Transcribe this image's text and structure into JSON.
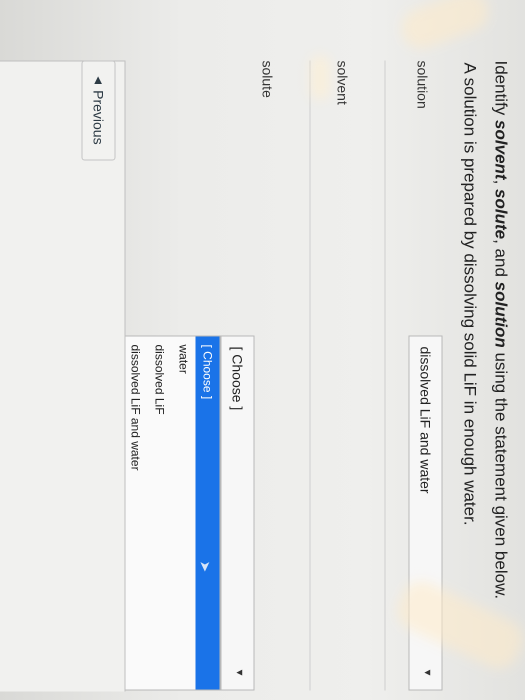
{
  "question": {
    "prompt_start": "Identify ",
    "term1": "solvent",
    "sep1": ", ",
    "term2": "solute",
    "sep2": ", and ",
    "term3": "solution",
    "prompt_end": " using the statement given below.",
    "statement": "A solution is prepared by dissolving solid LiF in enough water."
  },
  "rows": [
    {
      "label": "solution",
      "selected": "dissolved LiF and water"
    },
    {
      "label": "solvent",
      "selected": "[ Choose ]"
    },
    {
      "label": "solute"
    }
  ],
  "dropdown": {
    "options": [
      "[ Choose ]",
      "water",
      "dissolved LiF",
      "dissolved LiF and water"
    ],
    "highlighted": "[ Choose ]"
  },
  "nav": {
    "previous_label": "Previous",
    "previous_icon": "caret-left-icon"
  },
  "icons": {
    "select_arrow": "triangle-down-icon",
    "cursor": "mouse-cursor-icon"
  },
  "colors": {
    "highlight": "#1a73e8",
    "text": "#2d3b45"
  }
}
